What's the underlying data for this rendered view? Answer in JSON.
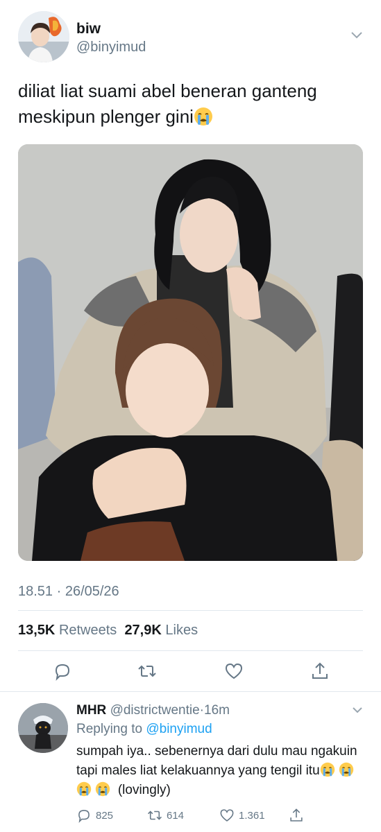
{
  "tweet": {
    "author_name": "biw",
    "author_handle": "@binyimud",
    "text": "diliat liat suami abel beneran ganteng meskipun plenger gini",
    "emoji": "loudly-crying-face",
    "timestamp": "18.51 · 26/05/26",
    "retweets_count": "13,5K",
    "retweets_label": "Retweets",
    "likes_count": "27,9K",
    "likes_label": "Likes"
  },
  "actions": {
    "reply_icon": "reply-icon",
    "retweet_icon": "retweet-icon",
    "like_icon": "heart-icon",
    "share_icon": "share-icon"
  },
  "reply": {
    "author_name": "MHR",
    "author_handle": "@districtwentie",
    "separator": "·",
    "time": "16m",
    "replying_prefix": "Replying to",
    "replying_to": "@binyimud",
    "text": "sumpah iya.. sebenernya dari dulu mau ngakuin tapi males liat kelakuannya yang tengil itu",
    "text_suffix": "(lovingly)",
    "emoji_count": 4,
    "reply_count": "825",
    "retweet_count": "614",
    "like_count": "1.361"
  },
  "colors": {
    "text_primary": "#14171a",
    "text_secondary": "#657786",
    "link": "#1da1f2",
    "divider": "#e1e8ed",
    "emoji_yellow": "#ffcc4d",
    "emoji_tear": "#5dadec"
  }
}
